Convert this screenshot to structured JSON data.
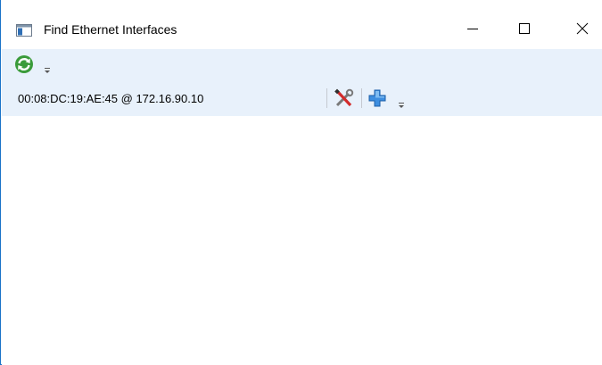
{
  "window": {
    "title": "Find Ethernet Interfaces",
    "border_color": "#1a73c8",
    "icons": {
      "app": "window-icon",
      "minimize": "minimize-icon",
      "maximize": "maximize-icon",
      "close": "close-icon"
    }
  },
  "toolbar": {
    "background": "#e8f1fb",
    "refresh_icon": "refresh-icon",
    "overflow_icon": "overflow-chevron-icon"
  },
  "interfaces": [
    {
      "label": "00:08:DC:19:AE:45 @ 172.16.90.10",
      "actions": [
        {
          "icon": "tools-icon"
        },
        {
          "icon": "add-icon"
        }
      ],
      "overflow_icon": "overflow-chevron-icon"
    }
  ]
}
